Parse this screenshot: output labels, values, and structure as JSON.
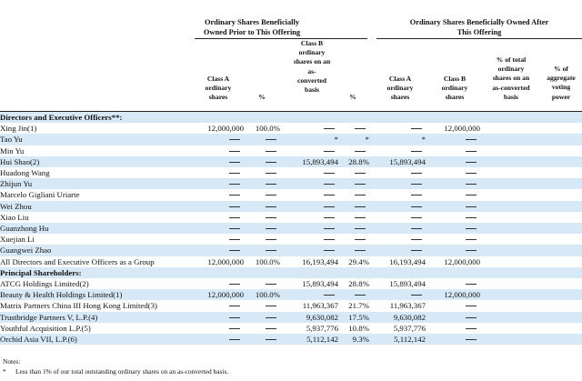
{
  "group_headers": {
    "prior": [
      "Ordinary Shares Beneficially",
      "Owned Prior to This Offering"
    ],
    "after": [
      "Ordinary Shares Beneficially Owned After",
      "This Offering"
    ]
  },
  "column_headers": {
    "class_a_prior": [
      "Class A",
      "ordinary",
      "shares"
    ],
    "pct_prior": [
      "%"
    ],
    "class_b_prior": [
      "Class B",
      "ordinary",
      "shares on an",
      "as-",
      "converted",
      "basis"
    ],
    "pct_b_prior": [
      "%"
    ],
    "class_a_after": [
      "Class A",
      "ordinary",
      "shares"
    ],
    "class_b_after": [
      "Class B",
      "ordinary",
      "shares"
    ],
    "pct_total_after": [
      "% of total",
      "ordinary",
      "shares on an",
      "as-converted",
      "basis"
    ],
    "pct_voting_after": [
      "% of",
      "aggregate",
      "voting",
      "power"
    ]
  },
  "rows": [
    {
      "type": "section",
      "name": "Directors and Executive Officers**:"
    },
    {
      "name": "Xing Jin(1)",
      "a": "12,000,000",
      "ap": "100.0%",
      "b": "—",
      "bp": "—",
      "a2": "—",
      "b2": "12,000,000",
      "tp": "",
      "vp": ""
    },
    {
      "name": "Tao Yu",
      "a": "—",
      "ap": "—",
      "b": "*",
      "bp": "*",
      "a2": "*",
      "b2": "—",
      "tp": "",
      "vp": ""
    },
    {
      "name": "Min Yu",
      "a": "—",
      "ap": "—",
      "b": "—",
      "bp": "—",
      "a2": "—",
      "b2": "—",
      "tp": "",
      "vp": ""
    },
    {
      "name": "Hui Shao(2)",
      "a": "—",
      "ap": "—",
      "b": "15,893,494",
      "bp": "28.8%",
      "a2": "15,893,494",
      "b2": "—",
      "tp": "",
      "vp": ""
    },
    {
      "name": "Huadong Wang",
      "a": "—",
      "ap": "—",
      "b": "—",
      "bp": "—",
      "a2": "—",
      "b2": "—",
      "tp": "",
      "vp": ""
    },
    {
      "name": "Zhijun Yu",
      "a": "—",
      "ap": "—",
      "b": "—",
      "bp": "—",
      "a2": "—",
      "b2": "—",
      "tp": "",
      "vp": ""
    },
    {
      "name": "Marcelo Gigliani Uriarte",
      "a": "—",
      "ap": "—",
      "b": "—",
      "bp": "—",
      "a2": "—",
      "b2": "—",
      "tp": "",
      "vp": ""
    },
    {
      "name": "Wei Zhou",
      "a": "—",
      "ap": "—",
      "b": "—",
      "bp": "—",
      "a2": "—",
      "b2": "—",
      "tp": "",
      "vp": ""
    },
    {
      "name": "Xiao Liu",
      "a": "—",
      "ap": "—",
      "b": "—",
      "bp": "—",
      "a2": "—",
      "b2": "—",
      "tp": "",
      "vp": ""
    },
    {
      "name": "Guanzhong Hu",
      "a": "—",
      "ap": "—",
      "b": "—",
      "bp": "—",
      "a2": "—",
      "b2": "—",
      "tp": "",
      "vp": ""
    },
    {
      "name": "Xuejian Li",
      "a": "—",
      "ap": "—",
      "b": "—",
      "bp": "—",
      "a2": "—",
      "b2": "—",
      "tp": "",
      "vp": ""
    },
    {
      "name": "Guangwei Zhao",
      "a": "—",
      "ap": "—",
      "b": "—",
      "bp": "—",
      "a2": "—",
      "b2": "—",
      "tp": "",
      "vp": ""
    },
    {
      "name": "All Directors and Executive Officers as a Group",
      "a": "12,000,000",
      "ap": "100.0%",
      "b": "16,193,494",
      "bp": "29.4%",
      "a2": "16,193,494",
      "b2": "12,000,000",
      "tp": "",
      "vp": ""
    },
    {
      "type": "section",
      "name": "Principal Shareholders:"
    },
    {
      "name": "ATCG Holdings Limited(2)",
      "a": "—",
      "ap": "—",
      "b": "15,893,494",
      "bp": "28.8%",
      "a2": "15,893,494",
      "b2": "—",
      "tp": "",
      "vp": ""
    },
    {
      "name": "Beauty & Health Holdings Limited(1)",
      "a": "12,000,000",
      "ap": "100.0%",
      "b": "—",
      "bp": "—",
      "a2": "—",
      "b2": "12,000,000",
      "tp": "",
      "vp": ""
    },
    {
      "name": "Matrix Partners China III Hong Kong Limited(3)",
      "a": "—",
      "ap": "—",
      "b": "11,963,367",
      "bp": "21.7%",
      "a2": "11,963,367",
      "b2": "—",
      "tp": "",
      "vp": ""
    },
    {
      "name": "Trustbridge Partners V, L.P.(4)",
      "a": "—",
      "ap": "—",
      "b": "9,630,082",
      "bp": "17.5%",
      "a2": "9,630,082",
      "b2": "—",
      "tp": "",
      "vp": ""
    },
    {
      "name": "Youthful Acquisition L.P.(5)",
      "a": "—",
      "ap": "—",
      "b": "5,937,776",
      "bp": "10.8%",
      "a2": "5,937,776",
      "b2": "—",
      "tp": "",
      "vp": ""
    },
    {
      "name": "Orchid Asia VII, L.P.(6)",
      "a": "—",
      "ap": "—",
      "b": "5,112,142",
      "bp": "9.3%",
      "a2": "5,112,142",
      "b2": "—",
      "tp": "",
      "vp": ""
    }
  ],
  "notes": {
    "heading": "Notes:",
    "mark": "*",
    "text": "Less than 1% of our total outstanding ordinary shares on an as-converted basis."
  }
}
